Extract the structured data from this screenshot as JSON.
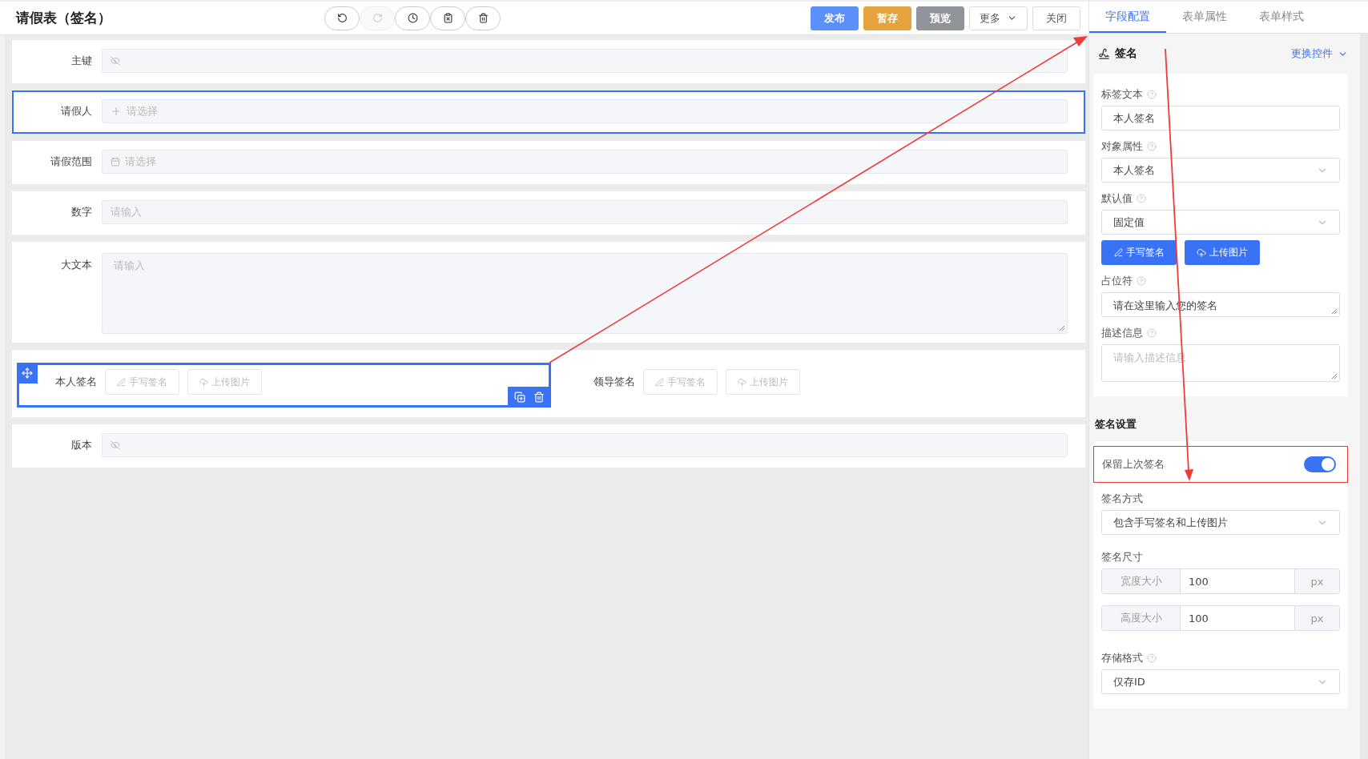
{
  "title": "请假表（签名）",
  "toolbar": [
    {
      "kind": "undo",
      "disabled": false
    },
    {
      "kind": "redo",
      "disabled": true
    },
    {
      "kind": "history",
      "disabled": false
    },
    {
      "kind": "clear",
      "disabled": false
    },
    {
      "kind": "delete",
      "disabled": false
    }
  ],
  "actions": [
    {
      "label": "发布",
      "kind": "primary"
    },
    {
      "label": "暂存",
      "kind": "warning"
    },
    {
      "label": "预览",
      "kind": "info"
    },
    {
      "label": "更多",
      "kind": "dropdown"
    },
    {
      "label": "关闭",
      "kind": "plain"
    }
  ],
  "tabs": [
    {
      "label": "字段配置",
      "selected": true
    },
    {
      "label": "表单属性",
      "selected": false
    },
    {
      "label": "表单样式",
      "selected": false
    }
  ],
  "form_fields": [
    {
      "kind": "hidden",
      "label": "主键",
      "selected": false
    },
    {
      "kind": "user",
      "label": "请假人",
      "placeholder": "请选择",
      "selected": true
    },
    {
      "kind": "date",
      "label": "请假范围",
      "placeholder": "请选择",
      "selected": false
    },
    {
      "kind": "input",
      "label": "数字",
      "placeholder": "请输入",
      "selected": false
    },
    {
      "kind": "textarea",
      "label": "大文本",
      "placeholder": "请输入",
      "selected": false
    },
    {
      "kind": "signatures",
      "items": [
        {
          "label": "本人签名",
          "selected": true,
          "buttons": [
            "手写签名",
            "上传图片"
          ]
        },
        {
          "label": "领导签名",
          "selected": false,
          "buttons": [
            "手写签名",
            "上传图片"
          ]
        }
      ]
    },
    {
      "kind": "hidden",
      "label": "版本",
      "selected": false
    }
  ],
  "panel": {
    "title": "签名",
    "action": "更换控件",
    "fields": [
      {
        "kind": "input",
        "label": "标签文本",
        "help": true,
        "value": "本人签名"
      },
      {
        "kind": "select",
        "label": "对象属性",
        "help": true,
        "value": "本人签名"
      },
      {
        "kind": "select",
        "label": "默认值",
        "help": true,
        "value": "固定值",
        "buttons": [
          "手写签名",
          "上传图片"
        ]
      },
      {
        "kind": "textarea",
        "label": "占位符",
        "help": true,
        "value": "请在这里输入您的签名"
      },
      {
        "kind": "textarea",
        "label": "描述信息",
        "help": true,
        "placeholder": "请输入描述信息"
      }
    ],
    "section_title": "签名设置",
    "settings": [
      {
        "kind": "switch",
        "label": "保留上次签名",
        "on": true,
        "highlighted": true
      },
      {
        "kind": "select",
        "label": "签名方式",
        "help": false,
        "value": "包含手写签名和上传图片"
      },
      {
        "kind": "size",
        "label": "签名尺寸",
        "help": false,
        "rows": [
          {
            "prefix": "宽度大小",
            "value": "100",
            "suffix": "px"
          },
          {
            "prefix": "高度大小",
            "value": "100",
            "suffix": "px"
          }
        ]
      },
      {
        "kind": "select",
        "label": "存储格式",
        "help": true,
        "value": "仅存ID"
      }
    ]
  }
}
